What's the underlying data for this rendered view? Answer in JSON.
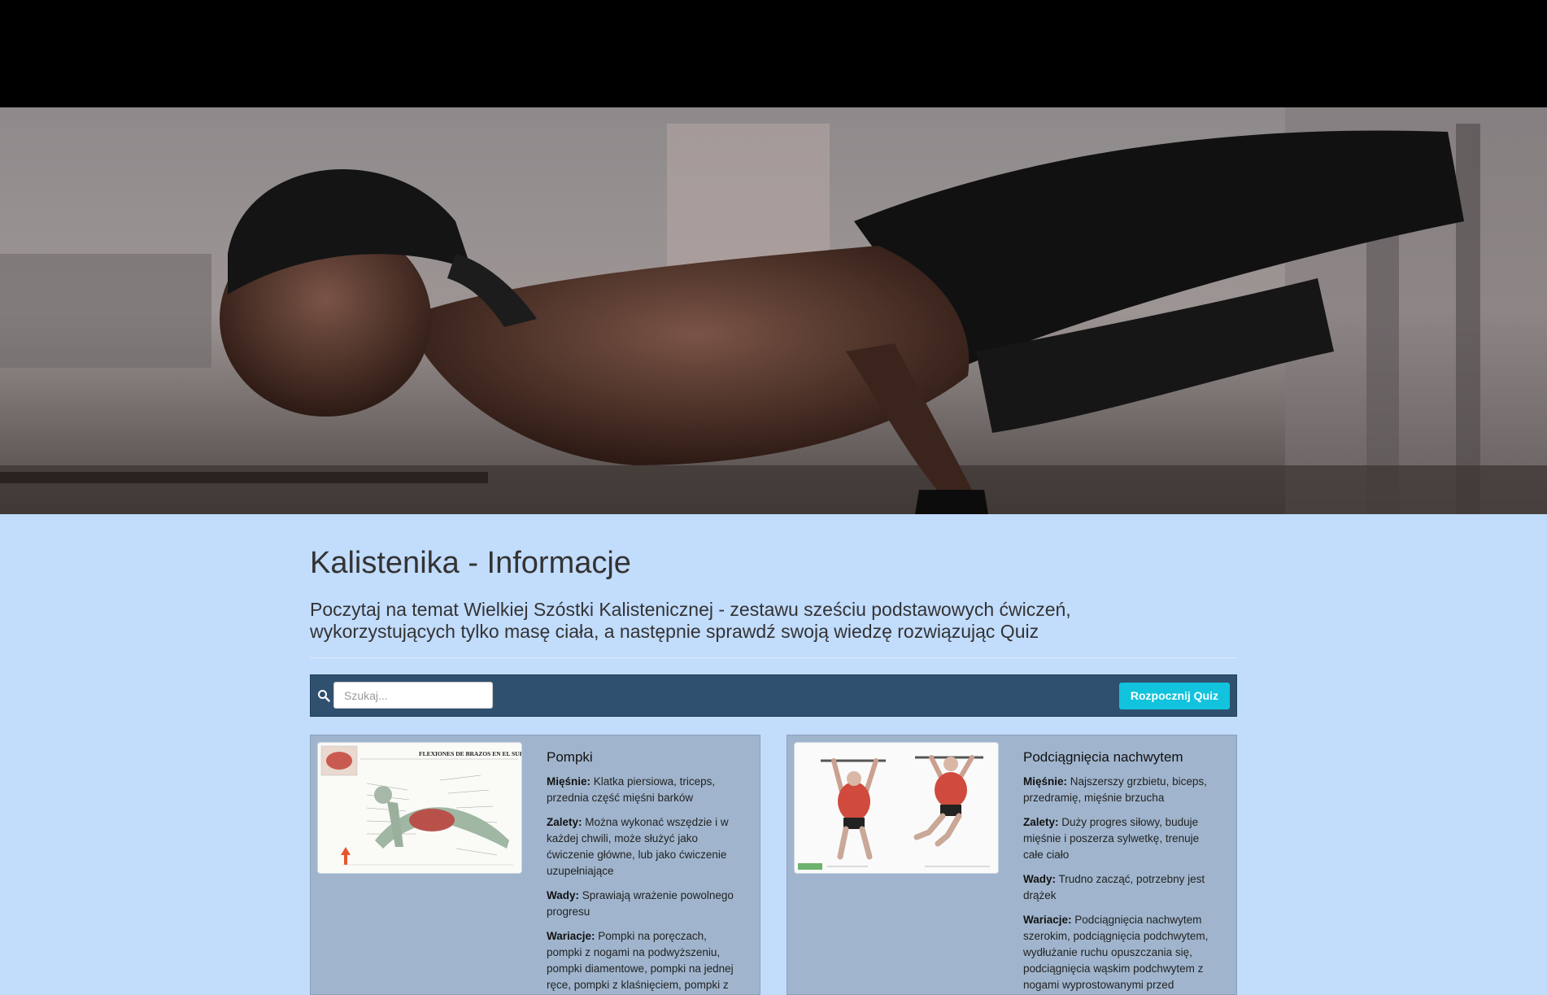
{
  "hero": {
    "alt": "calisthenics athlete performing planche"
  },
  "page": {
    "title": "Kalistenika - Informacje",
    "subtitle": "Poczytaj na temat Wielkiej Szóstki Kalistenicznej - zestawu sześciu podstawowych ćwiczeń, wykorzystujących tylko masę ciała, a następnie sprawdź swoją wiedzę rozwiązując Quiz"
  },
  "toolbar": {
    "search_icon": "search-icon",
    "search_placeholder": "Szukaj...",
    "search_value": "",
    "quiz_button": "Rozpocznij Quiz"
  },
  "colors": {
    "background": "#c2dcfc",
    "toolbar": "#30506f",
    "button": "#12c3dd",
    "card": "#a0b5cd"
  },
  "cards": [
    {
      "title": "Pompki",
      "image_heading": "FLEXIONES DE BRAZOS EN EL SUELO",
      "muscles_label": "Mięśnie:",
      "muscles": "Klatka piersiowa, triceps, przednia część mięśni barków",
      "pros_label": "Zalety:",
      "pros": "Można wykonać wszędzie i w każdej chwili, może służyć jako ćwiczenie główne, lub jako ćwiczenie uzupełniające",
      "cons_label": "Wady:",
      "cons": "Sprawiają wrażenie powolnego progresu",
      "variations_label": "Wariacje:",
      "variations": "Pompki na poręczach, pompki z nogami na podwyższeniu, pompki diamentowe, pompki na jednej ręce, pompki z klaśnięciem, pompki z"
    },
    {
      "title": "Podciągnięcia nachwytem",
      "muscles_label": "Mięśnie:",
      "muscles": "Najszerszy grzbietu, biceps, przedramię, mięśnie brzucha",
      "pros_label": "Zalety:",
      "pros": "Duży progres siłowy, buduje mięśnie i poszerza sylwetkę, trenuje całe ciało",
      "cons_label": "Wady:",
      "cons": "Trudno zacząć, potrzebny jest drążek",
      "variations_label": "Wariacje:",
      "variations": "Podciągnięcia nachwytem szerokim, podciągnięcia podchwytem, wydłużanie ruchu opuszczania się, podciągnięcia wąskim podchwytem z nogami wyprostowanymi przed sylwetką"
    }
  ]
}
